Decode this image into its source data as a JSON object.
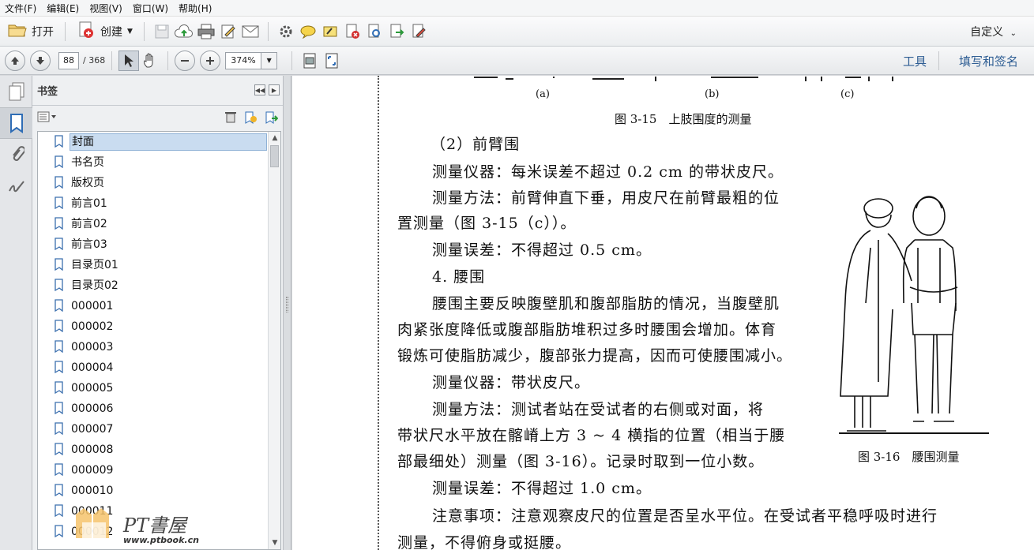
{
  "menu": [
    "文件(F)",
    "编辑(E)",
    "视图(V)",
    "窗口(W)",
    "帮助(H)"
  ],
  "toolbar": {
    "open_label": "打开",
    "create_label": "创建",
    "custom_label": "自定义"
  },
  "nav": {
    "current_page": "88",
    "total_pages": "/ 368",
    "zoom": "374%",
    "tools_label": "工具",
    "sign_label": "填写和签名"
  },
  "panel": {
    "title": "书签",
    "bookmarks": [
      "封面",
      "书名页",
      "版权页",
      "前言01",
      "前言02",
      "前言03",
      "目录页01",
      "目录页02",
      "000001",
      "000002",
      "000003",
      "000004",
      "000005",
      "000006",
      "000007",
      "000008",
      "000009",
      "000010",
      "000011",
      "000012"
    ],
    "selected": "封面"
  },
  "document": {
    "fig_sub_a": "(a)",
    "fig_sub_b": "(b)",
    "fig_sub_c": "(c)",
    "fig315_caption": "图 3-15　上肢围度的测量",
    "h_forearm": "（2）前臂围",
    "forearm_instr": "测量仪器：每米误差不超过 0.2 cm 的带状皮尺。",
    "forearm_method_1": "测量方法：前臂伸直下垂，用皮尺在前臂最粗的位",
    "forearm_method_2": "置测量（图 3-15（c））。",
    "forearm_error": "测量误差：不得超过 0.5 cm。",
    "h_waist": "4. 腰围",
    "waist_p1_1": "腰围主要反映腹壁肌和腹部脂肪的情况，当腹壁肌",
    "waist_p1_2": "肉紧张度降低或腹部脂肪堆积过多时腰围会增加。体育",
    "waist_p1_3": "锻炼可使脂肪减少，腹部张力提高，因而可使腰围减小。",
    "waist_instr": "测量仪器：带状皮尺。",
    "waist_method_1": "测量方法：测试者站在受试者的右侧或对面，将",
    "waist_method_2": "带状尺水平放在髂嵴上方 3 ~ 4 横指的位置（相当于腰",
    "waist_method_3": "部最细处）测量（图 3-16）。记录时取到一位小数。",
    "waist_error": "测量误差：不得超过 1.0 cm。",
    "waist_note_1": "注意事项：注意观察皮尺的位置是否呈水平位。在受试者平稳呼吸时进行",
    "waist_note_2": "测量，不得俯身或挺腰。",
    "fig316_caption": "图 3-16　腰围测量"
  },
  "watermark": {
    "brand": "PT書屋",
    "url": "www.ptbook.cn"
  }
}
